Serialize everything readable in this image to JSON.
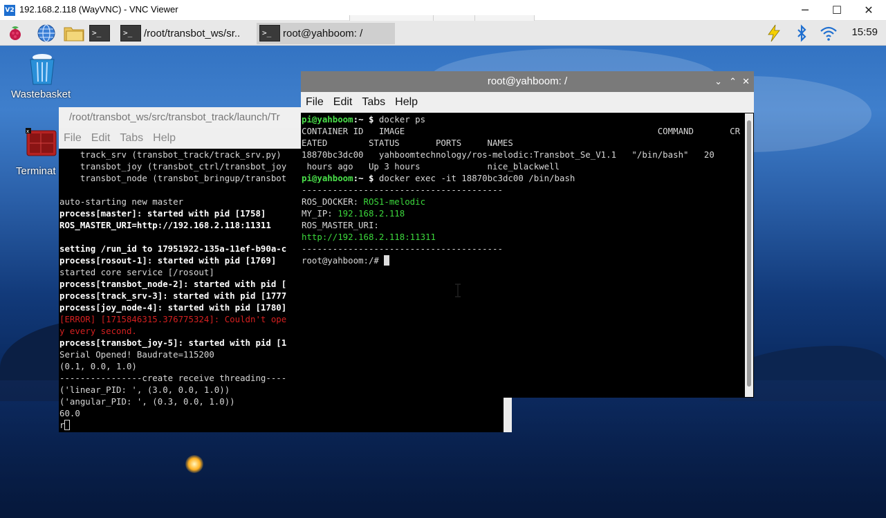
{
  "vnc": {
    "logo": "V2",
    "title": "192.168.2.118 (WayVNC) - VNC Viewer",
    "minimize": "─",
    "maximize": "☐",
    "close": "✕"
  },
  "taskbar": {
    "tasks": [
      {
        "label": "/root/transbot_ws/sr..",
        "icon": "terminal-icon"
      },
      {
        "label": "root@yahboom: /",
        "icon": "terminal-icon"
      }
    ],
    "clock": "15:59",
    "icons": [
      "raspberry-menu-icon",
      "web-browser-icon",
      "file-manager-icon",
      "terminal-icon",
      "lightning-icon",
      "bluetooth-icon",
      "wifi-icon"
    ]
  },
  "desktop": {
    "icons": [
      {
        "label": "Wastebasket",
        "icon": "wastebasket-icon"
      },
      {
        "label": "Terminat",
        "icon": "terminal-app-icon"
      }
    ]
  },
  "back_window": {
    "title": "/root/transbot_ws/src/transbot_track/launch/Tr",
    "menu": [
      "File",
      "Edit",
      "Tabs",
      "Help"
    ],
    "lines": [
      [
        {
          "t": "    track_srv (transbot_track/track_srv.py)",
          "c": ""
        }
      ],
      [
        {
          "t": "    transbot_joy (transbot_ctrl/transbot_joy",
          "c": ""
        }
      ],
      [
        {
          "t": "    transbot_node (transbot_bringup/transbot",
          "c": ""
        }
      ],
      [
        {
          "t": "",
          "c": ""
        }
      ],
      [
        {
          "t": "auto-starting new master",
          "c": ""
        }
      ],
      [
        {
          "t": "process[master]: started with pid [1758]",
          "c": "b"
        }
      ],
      [
        {
          "t": "ROS_MASTER_URI=http://192.168.2.118:11311",
          "c": "b"
        }
      ],
      [
        {
          "t": "",
          "c": ""
        }
      ],
      [
        {
          "t": "setting /run_id to 17951922-135a-11ef-b90a-c",
          "c": "b"
        }
      ],
      [
        {
          "t": "process[rosout-1]: started with pid [1769]",
          "c": "b"
        }
      ],
      [
        {
          "t": "started core service [/rosout]",
          "c": ""
        }
      ],
      [
        {
          "t": "process[transbot_node-2]: started with pid [",
          "c": "b"
        }
      ],
      [
        {
          "t": "process[track_srv-3]: started with pid [1777",
          "c": "b"
        }
      ],
      [
        {
          "t": "process[joy_node-4]: started with pid [1780]",
          "c": "b"
        }
      ],
      [
        {
          "t": "[ERROR] [1715846315.376775324]: Couldn't ope",
          "c": "r"
        }
      ],
      [
        {
          "t": "y every second.",
          "c": "r"
        }
      ],
      [
        {
          "t": "process[transbot_joy-5]: started with pid [1",
          "c": "b"
        }
      ],
      [
        {
          "t": "Serial Opened! Baudrate=115200",
          "c": ""
        }
      ],
      [
        {
          "t": "(0.1, 0.0, 1.0)",
          "c": ""
        }
      ],
      [
        {
          "t": "----------------create receive threading----",
          "c": ""
        }
      ],
      [
        {
          "t": "('linear_PID: ', (3.0, 0.0, 1.0))",
          "c": ""
        }
      ],
      [
        {
          "t": "('angular_PID: ', (0.3, 0.0, 1.0))",
          "c": ""
        }
      ],
      [
        {
          "t": "60.0",
          "c": ""
        }
      ],
      [
        {
          "t": "r",
          "c": ""
        }
      ]
    ]
  },
  "front_window": {
    "title": "root@yahboom: /",
    "controls": [
      "⌄",
      "⌃",
      "✕"
    ],
    "menu": [
      "File",
      "Edit",
      "Tabs",
      "Help"
    ],
    "lines": [
      [
        {
          "t": "pi@yahboom",
          "c": "gb"
        },
        {
          "t": ":~ ",
          "c": "b"
        },
        {
          "t": "$ ",
          "c": "b"
        },
        {
          "t": "docker ps",
          "c": ""
        }
      ],
      [
        {
          "t": "CONTAINER ID   IMAGE                                                 COMMAND       CR",
          "c": ""
        }
      ],
      [
        {
          "t": "EATED        STATUS       PORTS     NAMES",
          "c": ""
        }
      ],
      [
        {
          "t": "18870bc3dc00   yahboomtechnology/ros-melodic:Transbot_Se_V1.1   \"/bin/bash\"   20",
          "c": ""
        }
      ],
      [
        {
          "t": " hours ago   Up 3 hours             nice_blackwell",
          "c": ""
        }
      ],
      [
        {
          "t": "pi@yahboom",
          "c": "gb"
        },
        {
          "t": ":~ ",
          "c": "b"
        },
        {
          "t": "$ ",
          "c": "b"
        },
        {
          "t": "docker exec -it 18870bc3dc00 /bin/bash",
          "c": ""
        }
      ],
      [
        {
          "t": "---------------------------------------",
          "c": ""
        }
      ],
      [
        {
          "t": "ROS_DOCKER: ",
          "c": ""
        },
        {
          "t": "ROS1-melodic",
          "c": "g"
        }
      ],
      [
        {
          "t": "MY_IP: ",
          "c": ""
        },
        {
          "t": "192.168.2.118",
          "c": "g"
        }
      ],
      [
        {
          "t": "ROS_MASTER_URI:",
          "c": ""
        }
      ],
      [
        {
          "t": "http://192.168.2.118:11311",
          "c": "g"
        }
      ],
      [
        {
          "t": "---------------------------------------",
          "c": ""
        }
      ],
      [
        {
          "t": "root@yahboom:/# ",
          "c": ""
        }
      ]
    ]
  }
}
